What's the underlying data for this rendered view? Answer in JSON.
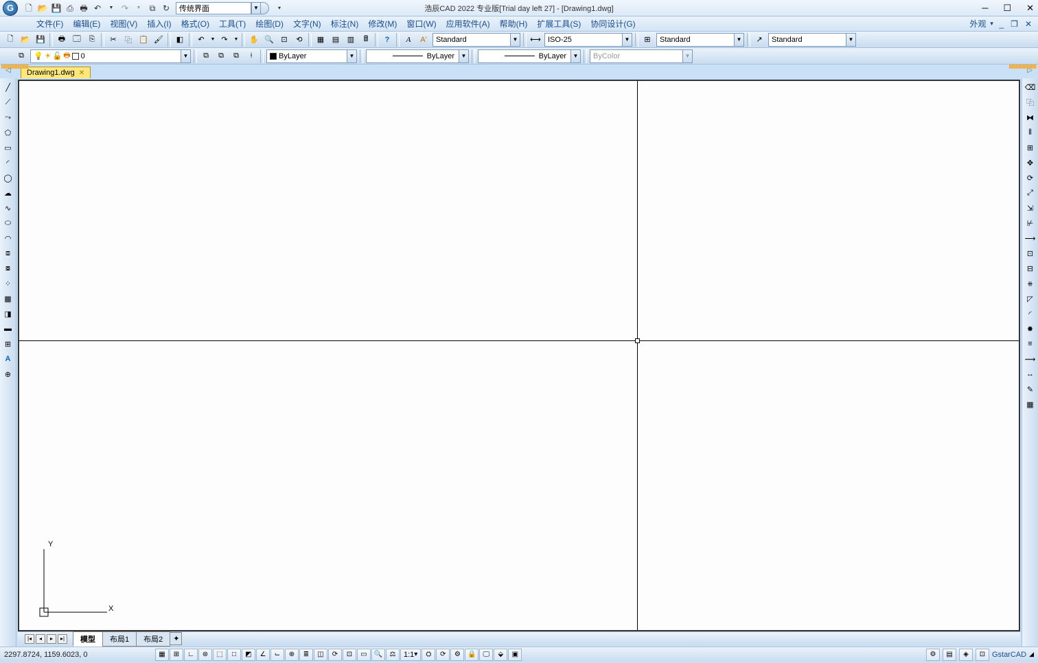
{
  "title": "浩辰CAD 2022 专业版[Trial day left 27] - [Drawing1.dwg]",
  "qat": {
    "workspace": "传统界面"
  },
  "menus": [
    "文件(F)",
    "编辑(E)",
    "视图(V)",
    "插入(I)",
    "格式(O)",
    "工具(T)",
    "绘图(D)",
    "文字(N)",
    "标注(N)",
    "修改(M)",
    "窗口(W)",
    "应用软件(A)",
    "帮助(H)",
    "扩展工具(S)",
    "协同设计(G)"
  ],
  "menu_right": "外观",
  "std": {
    "text_style": "Standard",
    "dim_style": "ISO-25",
    "table_style": "Standard",
    "mleader_style": "Standard"
  },
  "layer": {
    "name": "0"
  },
  "props": {
    "color": "ByLayer",
    "linetype": "ByLayer",
    "lineweight": "ByLayer",
    "plotstyle": "ByColor"
  },
  "doc_tab": "Drawing1.dwg",
  "sheet_tabs": [
    "模型",
    "布局1",
    "布局2"
  ],
  "coords": "2297.8724, 1159.6023, 0",
  "scale": "1:1",
  "brand": "GstarCAD",
  "ucs": {
    "x": "X",
    "y": "Y"
  }
}
